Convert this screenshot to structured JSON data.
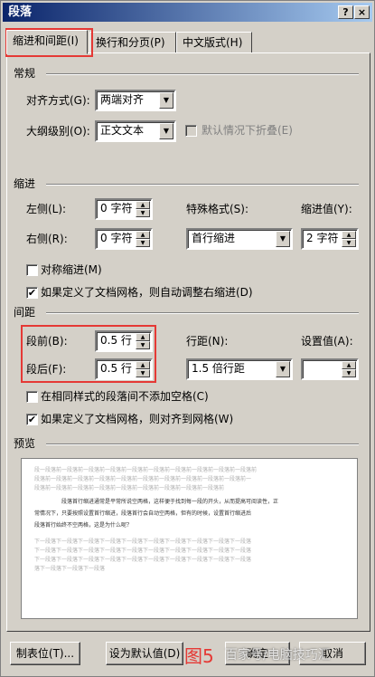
{
  "window": {
    "title": "段落",
    "help": "?",
    "close": "×"
  },
  "tabs": [
    "缩进和间距(I)",
    "换行和分页(P)",
    "中文版式(H)"
  ],
  "general": {
    "heading": "常规",
    "align_label": "对齐方式(G):",
    "align_value": "两端对齐",
    "outline_label": "大纲级别(O):",
    "outline_value": "正文文本",
    "collapse_label": "默认情况下折叠(E)"
  },
  "indent": {
    "heading": "缩进",
    "left_label": "左侧(L):",
    "left_value": "0 字符",
    "right_label": "右侧(R):",
    "right_value": "0 字符",
    "special_label": "特殊格式(S):",
    "special_value": "首行缩进",
    "by_label": "缩进值(Y):",
    "by_value": "2 字符",
    "mirror_label": "对称缩进(M)",
    "auto_adjust_label": "如果定义了文档网格，则自动调整右缩进(D)"
  },
  "spacing": {
    "heading": "间距",
    "before_label": "段前(B):",
    "before_value": "0.5 行",
    "after_label": "段后(F):",
    "after_value": "0.5 行",
    "line_label": "行距(N):",
    "line_value": "1.5 倍行距",
    "at_label": "设置值(A):",
    "at_value": "",
    "no_space_label": "在相同样式的段落间不添加空格(C)",
    "snap_grid_label": "如果定义了文档网格，则对齐到网格(W)"
  },
  "preview": {
    "heading": "预览",
    "prev_lines": [
      "段一段落前一段落前一段落前一段落前一段落前一段落前一段落前一段落前一段落前一段落前",
      "段落前一段落前一段落前一段落前一段落前一段落前一段落前一段落前一段落前一段落前一",
      "段落前一段落前一段落前一段落前一段落前一段落前一段落前一段落前一段落前"
    ],
    "sample_lines": [
      "段落首行缩进通常是平常所说空两格，这样便于找到每一段的开头，从而提高可阅读性，正",
      "常情况下，只要按照设置首行缩进，段落首行会自动空两格，但有的时候，设置首行缩进后",
      "段落首行始终不空两格，这是为什么呢？"
    ],
    "next_lines": [
      "下一段落下一段落下一段落下一段落下一段落下一段落下一段落下一段落下一段落下一段落",
      "下一段落下一段落下一段落下一段落下一段落下一段落下一段落下一段落下一段落下一段落",
      "下一段落下一段落下一段落下一段落下一段落下一段落下一段落下一段落下一段落下一段落",
      "落下一段落下一段落下一段落"
    ]
  },
  "buttons": {
    "tabs": "制表位(T)...",
    "default": "设为默认值(D)",
    "ok": "确定",
    "cancel": "取消"
  },
  "annotation": {
    "figure": "图5",
    "watermark": "百家号/电脑技巧汇",
    "highlight_color": "#e53935"
  },
  "checkboxes": {
    "collapse": false,
    "mirror": false,
    "auto_adjust": true,
    "no_space": false,
    "snap_grid": true
  }
}
